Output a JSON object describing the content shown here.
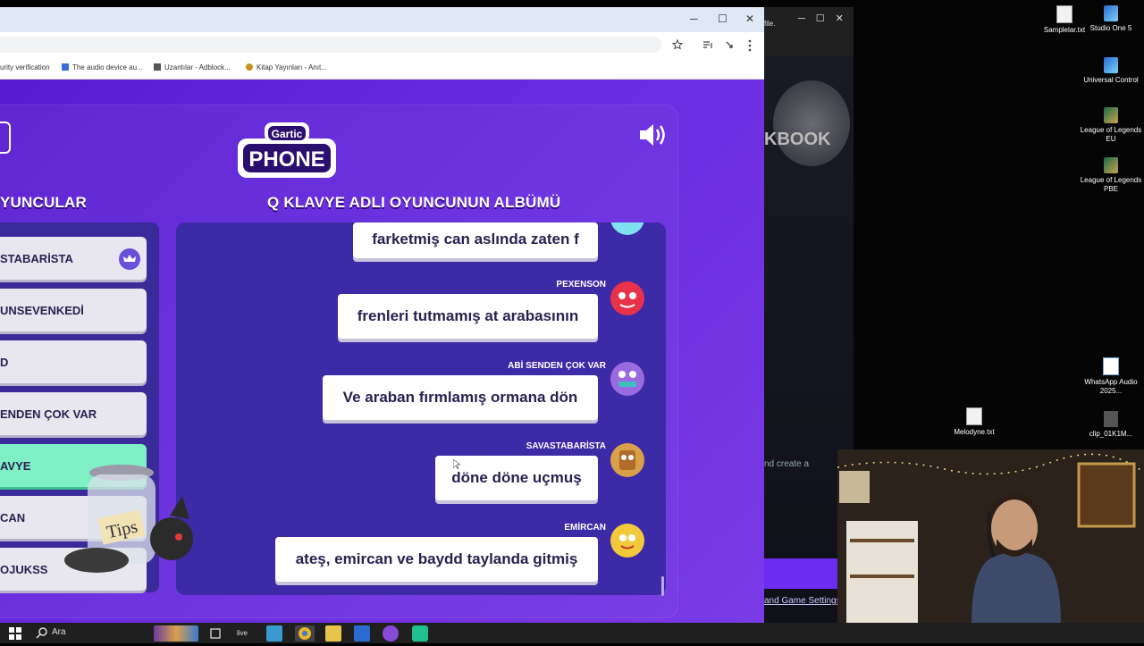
{
  "browser": {
    "bookmarks": [
      {
        "label": "urity verification",
        "icon": "page-icon"
      },
      {
        "label": "The audio device au...",
        "icon": "grid-icon"
      },
      {
        "label": "Uzantılar - Adblock...",
        "icon": "puzzle-icon"
      },
      {
        "label": "Kitap Yayınları - Anıt...",
        "icon": "circle-logo-icon"
      }
    ]
  },
  "game": {
    "logo_top": "Gartic",
    "logo_bottom": "PHONE",
    "players_header": "YUNCULAR",
    "album_header": "Q KLAVYE ADLI OYUNCUNUN ALBÜMÜ",
    "players": [
      {
        "name": "STABARİSTA",
        "owner": true
      },
      {
        "name": "UNSEVENKEDİ"
      },
      {
        "name": "D"
      },
      {
        "name": "ENDEN ÇOK VAR"
      },
      {
        "name": "AVYE",
        "active": true
      },
      {
        "name": "CAN"
      },
      {
        "name": "OJUKSS"
      }
    ],
    "messages": [
      {
        "author": "",
        "text": "farketmiş can aslında zaten f"
      },
      {
        "author": "PEXENSON",
        "text": "frenleri tutmamış at arabasının"
      },
      {
        "author": "ABİ SENDEN ÇOK VAR",
        "text": "Ve araban fırmlamış ormana dön"
      },
      {
        "author": "SAVASTABARİSTA",
        "text": "döne döne uçmuş"
      },
      {
        "author": "EMİRCAN",
        "text": "ateş, emircan ve baydd taylanda gitmiş"
      }
    ],
    "tips_label": "Tips"
  },
  "background_window": {
    "partial_title": "file.",
    "banner": "KBOOK",
    "create_text": "nd create a",
    "settings_link": "and Game Settings"
  },
  "desktop": {
    "icons": [
      {
        "label": "Samplelar.txt"
      },
      {
        "label": "Studio One 5"
      },
      {
        "label": "Universal Control"
      },
      {
        "label": "League of Legends EU"
      },
      {
        "label": "League of Legends PBE"
      },
      {
        "label": "WhatsApp Audio 2025..."
      },
      {
        "label": "Melodyne.txt"
      },
      {
        "label": "clip_01K1M..."
      }
    ]
  },
  "taskbar": {
    "search_placeholder": "Ara"
  },
  "colors": {
    "game_purple": "#6a2be0",
    "active_player": "#7ff0c5",
    "album_bg": "#3d2aa6",
    "titlebar": "#dfe9f6"
  }
}
